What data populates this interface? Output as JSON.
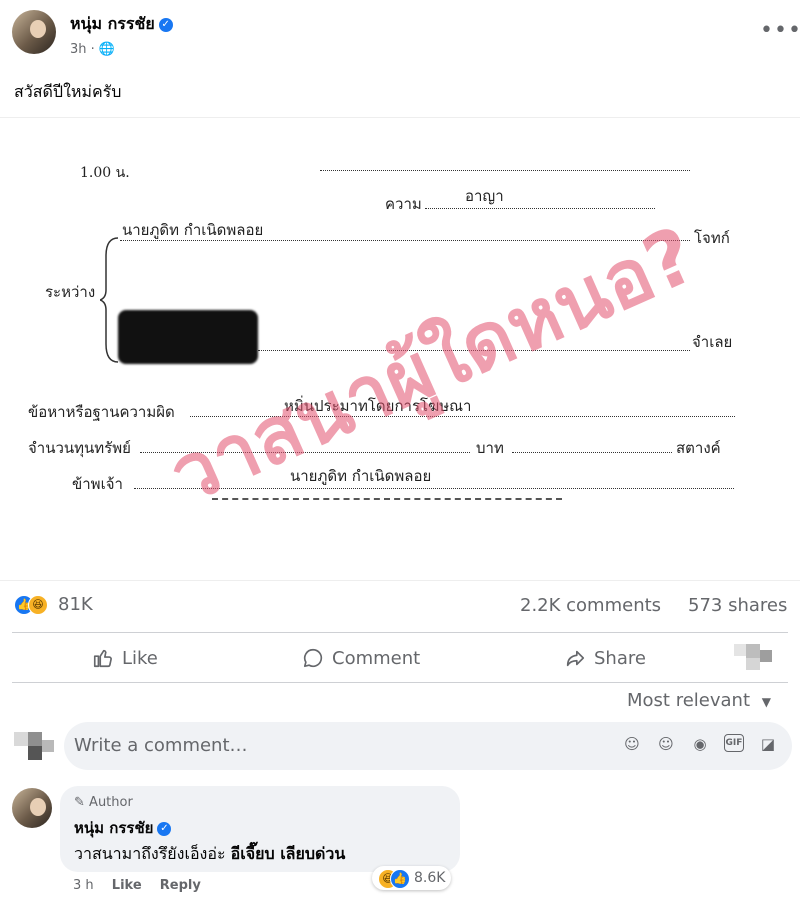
{
  "post": {
    "author": "หนุ่ม กรรชัย",
    "time": "3h",
    "audience_icon": "globe-icon",
    "text": "สวัสดีปีใหม่ครับ",
    "more_label": "•••"
  },
  "document": {
    "line_top_fragment": "1.00 น.",
    "charge_label": "ความ",
    "charge_value": "อาญา",
    "plaintiff_name": "นายภูดิท กำเนิดพลอย",
    "plaintiff_label": "โจทก์",
    "between_label": "ระหว่าง",
    "defendant_label": "จำเลย",
    "offense_label": "ข้อหาหรือฐานความผิด",
    "offense_value": "หมิ่นประมาทโดยการโฆษณา",
    "amount_label": "จำนวนทุนทรัพย์",
    "baht_label": "บาท",
    "satang_label": "สตางค์",
    "me_label": "ข้าพเจ้า",
    "me_value": "นายภูดิท กำเนิดพลอย",
    "watermark": "วาสนาผู้ใดหนอ?"
  },
  "stats": {
    "reactions": "81K",
    "comments": "2.2K comments",
    "shares": "573 shares"
  },
  "actions": {
    "like": "Like",
    "comment": "Comment",
    "share": "Share"
  },
  "sort_label": "Most relevant",
  "comment_box": {
    "placeholder": "Write a comment…",
    "icons": [
      "sticker-avatar-icon",
      "emoji-icon",
      "camera-icon",
      "gif-icon",
      "sticker-icon"
    ]
  },
  "top_comment": {
    "author_tag": "Author",
    "author": "หนุ่ม กรรชัย",
    "text_plain": "วาสนามาถึงรึยังเอ็งอ่ะ ",
    "text_bold": "อีเจี๊ยบ เลียบด่วน",
    "time": "3 h",
    "like": "Like",
    "reply": "Reply",
    "reaction_count": "8.6K"
  },
  "colors": {
    "accent": "#1877f2",
    "secondary_text": "#65676b",
    "watermark": "#e1506e"
  }
}
